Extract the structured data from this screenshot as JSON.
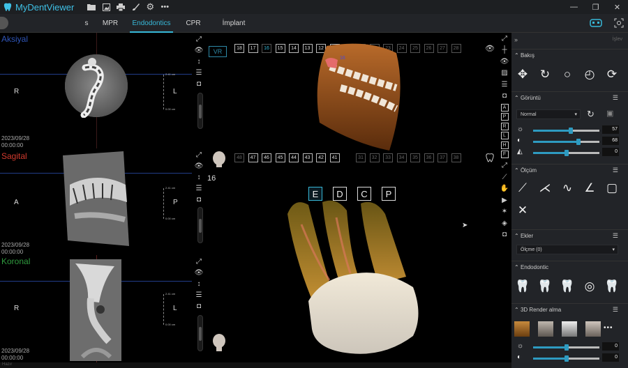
{
  "app": {
    "title": "MyDentViewer"
  },
  "tabs": [
    {
      "label": "s"
    },
    {
      "label": "MPR"
    },
    {
      "label": "Endodontics"
    },
    {
      "label": "CPR"
    },
    {
      "label": "İmplant"
    }
  ],
  "panels": {
    "axial": {
      "name": "Aksiyal",
      "name_color": "#2f55b8",
      "left": "R",
      "right": "L",
      "date": "2023/09/28",
      "time": "00:00:00"
    },
    "sagittal": {
      "name": "Sagital",
      "name_color": "#d23a2e",
      "left": "A",
      "right": "P",
      "date": "2023/09/28",
      "time": "00:00:00"
    },
    "coronal": {
      "name": "Koronal",
      "name_color": "#2f9a3e",
      "left": "R",
      "right": "L",
      "date": "2023/09/28",
      "time": "00:00:00"
    },
    "scale": {
      "top": "2.41 cm",
      "bottom": "0.00 cm"
    }
  },
  "vr": {
    "label": "VR"
  },
  "upper_teeth": [
    "18",
    "17",
    "16",
    "15",
    "14",
    "13",
    "12",
    "11",
    "21",
    "22",
    "23",
    "24",
    "25",
    "26",
    "27",
    "28"
  ],
  "lower_teeth": [
    "48",
    "47",
    "46",
    "45",
    "44",
    "43",
    "42",
    "41",
    "31",
    "32",
    "33",
    "34",
    "35",
    "36",
    "37",
    "38"
  ],
  "selected_tooth": "16",
  "tooth_marker": "16",
  "views": [
    "E",
    "D",
    "C",
    "P"
  ],
  "active_view": "E",
  "sidebar": {
    "header_right": "İşlev",
    "bakis": {
      "title": "Bakış"
    },
    "goruntu": {
      "title": "Görüntü",
      "mode": "Normal",
      "sliders": [
        {
          "value": "57",
          "fraction": 0.57
        },
        {
          "value": "68",
          "fraction": 0.68
        },
        {
          "value": "0",
          "fraction": 0.5
        }
      ]
    },
    "olcum": {
      "title": "Ölçüm"
    },
    "ekler": {
      "title": "Ekler",
      "select": "Ölçme (0)"
    },
    "endodontic": {
      "title": "Endodontic"
    },
    "render": {
      "title": "3D Render alma",
      "more": "•••",
      "sliders": [
        {
          "value": "0",
          "fraction": 0.5
        },
        {
          "value": "0",
          "fraction": 0.5
        }
      ]
    }
  },
  "status": {
    "text": "Hazır"
  },
  "colors": {
    "accent": "#37b9d9",
    "panel_bg": "#222428"
  }
}
